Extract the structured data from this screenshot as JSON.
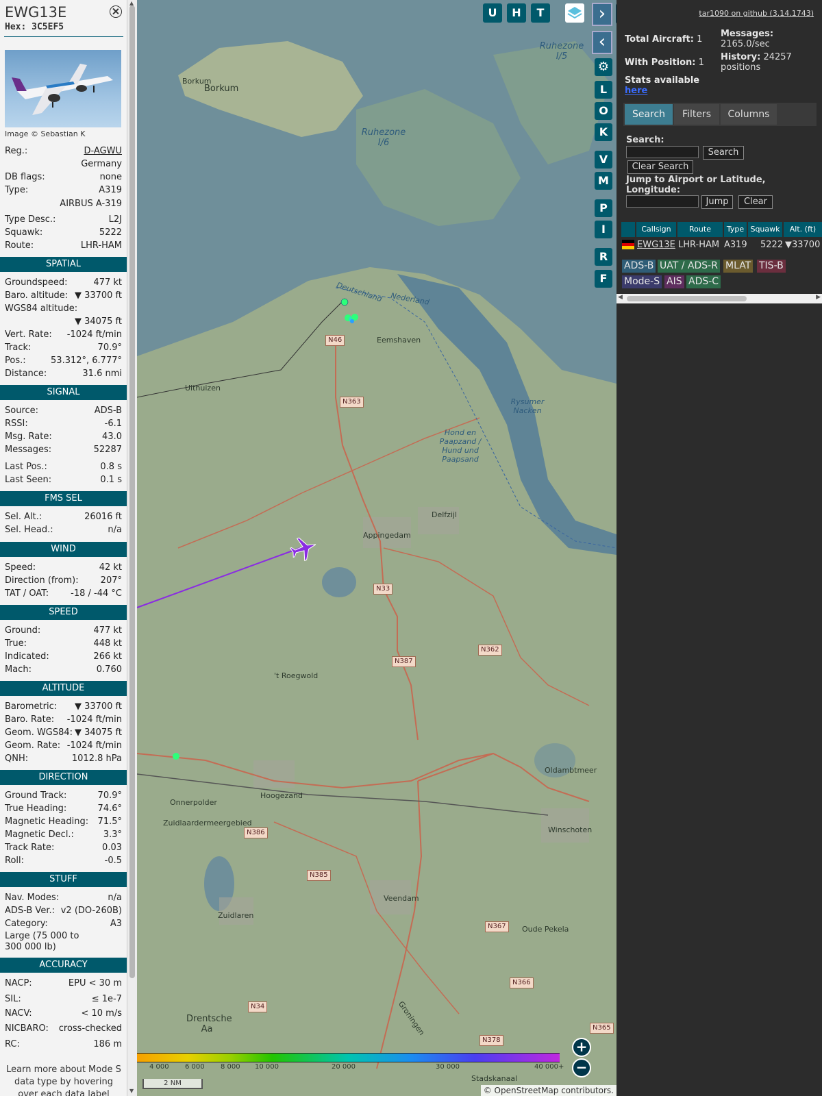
{
  "aircraft": {
    "callsign": "EWG13E",
    "hex_label": "Hex:",
    "hex": "3C5EF5",
    "photo_credit": "Image © Sebastian K",
    "reg_label": "Reg.:",
    "reg": "D-AGWU",
    "country": "Germany",
    "dbflags_label": "DB flags:",
    "dbflags": "none",
    "type_label": "Type:",
    "type": "A319",
    "type_name": "AIRBUS A-319",
    "typedesc_label": "Type Desc.:",
    "typedesc": "L2J",
    "squawk_label": "Squawk:",
    "squawk": "5222",
    "route_label": "Route:",
    "route": "LHR-HAM"
  },
  "sections": {
    "spatial": "SPATIAL",
    "signal": "SIGNAL",
    "fms": "FMS SEL",
    "wind": "WIND",
    "speed": "SPEED",
    "altitude": "ALTITUDE",
    "direction": "DIRECTION",
    "stuff": "STUFF",
    "accuracy": "ACCURACY"
  },
  "spatial": {
    "groundspeed_label": "Groundspeed:",
    "groundspeed": "477 kt",
    "baro_label": "Baro. altitude:",
    "baro": "▼ 33700 ft",
    "wgs_label": "WGS84 altitude:",
    "wgs": "▼ 34075 ft",
    "vrate_label": "Vert. Rate:",
    "vrate": "-1024 ft/min",
    "track_label": "Track:",
    "track": "70.9°",
    "pos_label": "Pos.:",
    "pos": "53.312°, 6.777°",
    "dist_label": "Distance:",
    "dist": "31.6 nmi"
  },
  "signal": {
    "source_label": "Source:",
    "source": "ADS-B",
    "rssi_label": "RSSI:",
    "rssi": "-6.1",
    "msgrate_label": "Msg. Rate:",
    "msgrate": "43.0",
    "messages_label": "Messages:",
    "messages": "52287",
    "lastpos_label": "Last Pos.:",
    "lastpos": "0.8 s",
    "lastseen_label": "Last Seen:",
    "lastseen": "0.1 s"
  },
  "fms": {
    "selalt_label": "Sel. Alt.:",
    "selalt": "26016 ft",
    "selhead_label": "Sel. Head.:",
    "selhead": "n/a"
  },
  "wind": {
    "speed_label": "Speed:",
    "speed": "42 kt",
    "dir_label": "Direction (from):",
    "dir": "207°",
    "tat_label": "TAT / OAT:",
    "tat": "-18 / -44 °C"
  },
  "speed": {
    "ground_label": "Ground:",
    "ground": "477 kt",
    "true_label": "True:",
    "true": "448 kt",
    "ias_label": "Indicated:",
    "ias": "266 kt",
    "mach_label": "Mach:",
    "mach": "0.760"
  },
  "altitude": {
    "baro_label": "Barometric:",
    "baro": "▼ 33700 ft",
    "barorate_label": "Baro. Rate:",
    "barorate": "-1024 ft/min",
    "geom_label": "Geom. WGS84:",
    "geom": "▼ 34075 ft",
    "geomrate_label": "Geom. Rate:",
    "geomrate": "-1024 ft/min",
    "qnh_label": "QNH:",
    "qnh": "1012.8 hPa"
  },
  "direction": {
    "gtrack_label": "Ground Track:",
    "gtrack": "70.9°",
    "thead_label": "True Heading:",
    "thead": "74.6°",
    "mhead_label": "Magnetic Heading:",
    "mhead": "71.5°",
    "mdecl_label": "Magnetic Decl.:",
    "mdecl": "3.3°",
    "trate_label": "Track Rate:",
    "trate": "0.03",
    "roll_label": "Roll:",
    "roll": "-0.5"
  },
  "stuff": {
    "navmodes_label": "Nav. Modes:",
    "navmodes": "n/a",
    "adsbver_label": "ADS-B Ver.:",
    "adsbver": "v2 (DO-260B)",
    "cat_label": "Category:",
    "cat": "A3",
    "cat_desc": "Large (75 000 to 300 000 lb)"
  },
  "accuracy": {
    "nacp_label": "NACP:",
    "nacp": "EPU < 30 m",
    "sil_label": "SIL:",
    "sil": "≤ 1e-7",
    "nacv_label": "NACV:",
    "nacv": "< 10 m/s",
    "nicbaro_label": "NICBARO:",
    "nicbaro": "cross-checked",
    "rc_label": "RC:",
    "rc": "186 m"
  },
  "footer_note": "Learn more about Mode S data type by hovering over each data label",
  "map": {
    "buttons_top": [
      "U",
      "H",
      "T"
    ],
    "buttons_side": [
      "L",
      "O",
      "K",
      "V",
      "M",
      "P",
      "I",
      "R",
      "F"
    ],
    "labels": {
      "borkum": "Borkum",
      "borkum_town": "Borkum",
      "ruhezone_i6": "Ruhezone I/6",
      "ruhezone_i5": "Ruhezone I/5",
      "uithuizen": "Uithuizen",
      "eemshaven": "Eemshaven",
      "appingedam": "Appingedam",
      "delfzijl": "Delfzijl",
      "hond": "Hond en Paapzand / Hund und Paapsand",
      "rysumer": "Rysumer Nacken",
      "deutschland": "Deutschland",
      "nederland": "Nederland",
      "hoogezand": "Hoogezand",
      "winschoten": "Winschoten",
      "veendam": "Veendam",
      "zuidlaren": "Zuidlaren",
      "oude_pekela": "Oude Pekela",
      "stadskanaal": "Stadskanaal",
      "drentsche": "Drentsche Aa",
      "roegwold": "'t Roegwold",
      "oldambtmeer": "Oldambtmeer",
      "onnerpolder": "Onnerpolder",
      "zuidlaardermeer": "Zuidlaardermeergebied",
      "groningen": "Groningen"
    },
    "roads": [
      "N46",
      "N363",
      "N33",
      "N362",
      "N387",
      "N386",
      "N385",
      "N367",
      "N366",
      "N34",
      "N378",
      "N365"
    ],
    "altitude_scale": [
      "4 000",
      "6 000",
      "8 000",
      "10 000",
      "20 000",
      "30 000",
      "40 000+"
    ],
    "scale_label": "2 NM",
    "attribution": "© OpenStreetMap contributors."
  },
  "right": {
    "github": "tar1090 on github (3.14.1743)",
    "total_label": "Total Aircraft:",
    "total": "1",
    "withpos_label": "With Position:",
    "withpos": "1",
    "messages_label": "Messages:",
    "messages": "2165.0/sec",
    "history_label": "History:",
    "history": "24257 positions",
    "stats_label": "Stats available",
    "stats_link": "here",
    "tabs": [
      "Search",
      "Filters",
      "Columns"
    ],
    "search_label": "Search:",
    "search_btn": "Search",
    "clear_search_btn": "Clear Search",
    "jump_label": "Jump to Airport or Latitude, Longitude:",
    "jump_btn": "Jump",
    "clear_btn": "Clear",
    "table_headers": [
      "Callsign",
      "Route",
      "Type",
      "Squawk",
      "Alt. (ft)"
    ],
    "table_row": {
      "callsign": "EWG13E",
      "route": "LHR-HAM",
      "type": "A319",
      "squawk": "5222",
      "alt": "▼33700"
    },
    "sources": [
      "ADS-B",
      "UAT / ADS-R",
      "MLAT",
      "TIS-B",
      "Mode-S",
      "AIS",
      "ADS-C"
    ],
    "colors": {
      "adsb": "#2f5d77",
      "uat": "#2e6b4a",
      "mlat": "#6b5b2e",
      "tisb": "#6b2e3e",
      "modes": "#3b3b6b",
      "ais": "#5e2e5e",
      "adsc": "#2e6b4a"
    }
  }
}
